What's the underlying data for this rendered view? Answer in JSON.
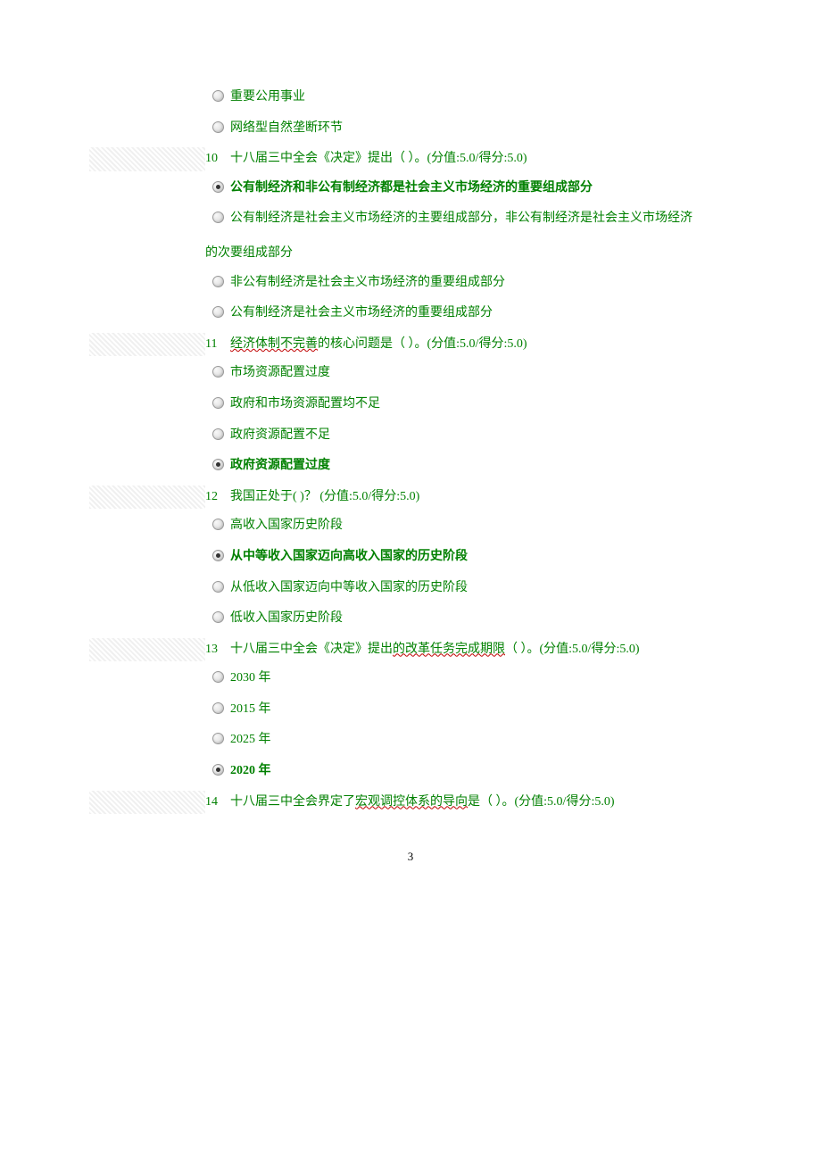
{
  "page_number": "3",
  "score_label": "(分值:5.0/得分:5.0)",
  "leading_options": [
    {
      "text": "重要公用事业",
      "selected": false
    },
    {
      "text": "网络型自然垄断环节",
      "selected": false
    }
  ],
  "questions": [
    {
      "num": "10",
      "stem_plain": "十八届三中全会《决定》提出（ ）。",
      "stem_wavy": "",
      "stem_suffix": "",
      "options": [
        {
          "text": "公有制经济和非公有制经济都是社会主义市场经济的重要组成部分",
          "selected": true,
          "bold": true
        },
        {
          "text": "公有制经济是社会主义市场经济的主要组成部分，非公有制经济是社会主义市场经济",
          "cont": "的次要组成部分",
          "selected": false,
          "bold": false
        },
        {
          "text": "非公有制经济是社会主义市场经济的重要组成部分",
          "selected": false,
          "bold": false
        },
        {
          "text": "公有制经济是社会主义市场经济的重要组成部分",
          "selected": false,
          "bold": false
        }
      ]
    },
    {
      "num": "11",
      "stem_wavy": "经济体制不完善",
      "stem_plain_after": "的核心问题是（ ）。",
      "options": [
        {
          "text": "市场资源配置过度",
          "selected": false,
          "bold": false
        },
        {
          "text": "政府和市场资源配置均不足",
          "selected": false,
          "bold": false
        },
        {
          "text": "政府资源配置不足",
          "selected": false,
          "bold": false
        },
        {
          "text": "政府资源配置过度",
          "selected": true,
          "bold": true
        }
      ]
    },
    {
      "num": "12",
      "stem_plain": "我国正处于( )？ ",
      "options": [
        {
          "text": "高收入国家历史阶段",
          "selected": false,
          "bold": false
        },
        {
          "text": "从中等收入国家迈向高收入国家的历史阶段",
          "selected": true,
          "bold": true
        },
        {
          "text": "从低收入国家迈向中等收入国家的历史阶段",
          "selected": false,
          "bold": false
        },
        {
          "text": "低收入国家历史阶段",
          "selected": false,
          "bold": false
        }
      ]
    },
    {
      "num": "13",
      "stem_prefix": "十八届三中全会《决定》提出",
      "stem_wavy": "的改革任务完成期限",
      "stem_plain_after": "（ ）。",
      "options": [
        {
          "text": "2030 年",
          "selected": false,
          "bold": false
        },
        {
          "text": "2015 年",
          "selected": false,
          "bold": false
        },
        {
          "text": "2025 年",
          "selected": false,
          "bold": false
        },
        {
          "text": "2020 年",
          "selected": true,
          "bold": true
        }
      ]
    },
    {
      "num": "14",
      "stem_prefix": "十八届三中全会界定了",
      "stem_wavy": "宏观调控体系的导向",
      "stem_plain_after": "是（ ）。"
    }
  ]
}
